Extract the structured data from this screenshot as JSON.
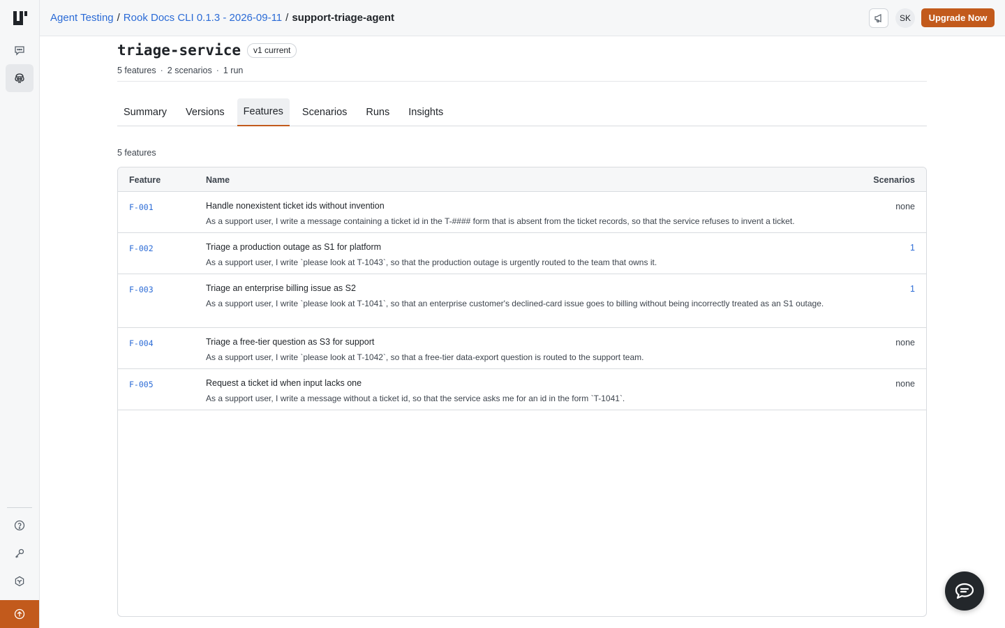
{
  "breadcrumb": {
    "items": [
      "Agent Testing",
      "Rook Docs CLI 0.1.3 - 2026-09-11"
    ],
    "separator": "/",
    "current": "support-triage-agent"
  },
  "topbar": {
    "avatar_initials": "SK",
    "upgrade_label": "Upgrade Now"
  },
  "header": {
    "title": "triage-service",
    "version_badge": "v1 current",
    "meta": [
      "5 features",
      "2 scenarios",
      "1 run"
    ],
    "meta_separator": "·"
  },
  "tabs": [
    "Summary",
    "Versions",
    "Features",
    "Scenarios",
    "Runs",
    "Insights"
  ],
  "active_tab": "Features",
  "count_label": "5 features",
  "table": {
    "headers": {
      "feature": "Feature",
      "name": "Name",
      "scenarios": "Scenarios"
    },
    "rows": [
      {
        "id": "F-001",
        "name": "Handle nonexistent ticket ids without invention",
        "desc": "As a support user, I write a message containing a ticket id in the T-#### form that is absent from the ticket records, so that the service refuses to invent a ticket.",
        "scenarios": "none"
      },
      {
        "id": "F-002",
        "name": "Triage a production outage as S1 for platform",
        "desc": "As a support user, I write `please look at T-1043`, so that the production outage is urgently routed to the team that owns it.",
        "scenarios": "1"
      },
      {
        "id": "F-003",
        "name": "Triage an enterprise billing issue as S2",
        "desc": "As a support user, I write `please look at T-1041`, so that an enterprise customer's declined-card issue goes to billing without being incorrectly treated as an S1 outage.",
        "scenarios": "1"
      },
      {
        "id": "F-004",
        "name": "Triage a free-tier question as S3 for support",
        "desc": "As a support user, I write `please look at T-1042`, so that a free-tier data-export question is routed to the support team.",
        "scenarios": "none"
      },
      {
        "id": "F-005",
        "name": "Request a ticket id when input lacks one",
        "desc": "As a support user, I write a message without a ticket id, so that the service asks me for an id in the form `T-1041`.",
        "scenarios": "none"
      }
    ]
  },
  "colors": {
    "accent": "#c25a1c",
    "link": "#2b6bd6",
    "chat_fab": "#23272b"
  },
  "icons": {
    "logo": "logo-icon",
    "sidebar_top": [
      "chat-icon",
      "agent-icon"
    ],
    "sidebar_bottom": [
      "help-icon",
      "key-icon",
      "settings-icon",
      "upgrade-arrow-icon"
    ],
    "topbar": "megaphone-icon",
    "fab": "chat-bubble-icon"
  }
}
